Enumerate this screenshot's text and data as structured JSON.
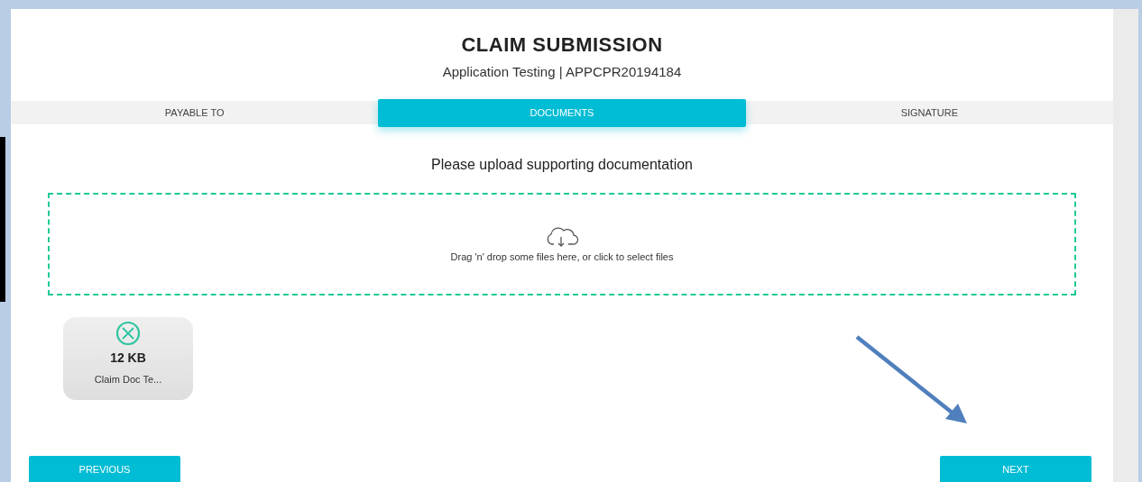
{
  "header": {
    "title": "CLAIM SUBMISSION",
    "subtitle": "Application Testing | APPCPR20194184"
  },
  "tabs": [
    {
      "label": "PAYABLE TO",
      "selected": false
    },
    {
      "label": "DOCUMENTS",
      "selected": true
    },
    {
      "label": "SIGNATURE",
      "selected": false
    }
  ],
  "instructions": "Please upload supporting documentation",
  "dropzone": {
    "text": "Drag 'n' drop some files here, or click to select files"
  },
  "files": [
    {
      "size": "12 KB",
      "name": "Claim Doc Te..."
    }
  ],
  "buttons": {
    "previous": "PREVIOUS",
    "next": "NEXT"
  }
}
